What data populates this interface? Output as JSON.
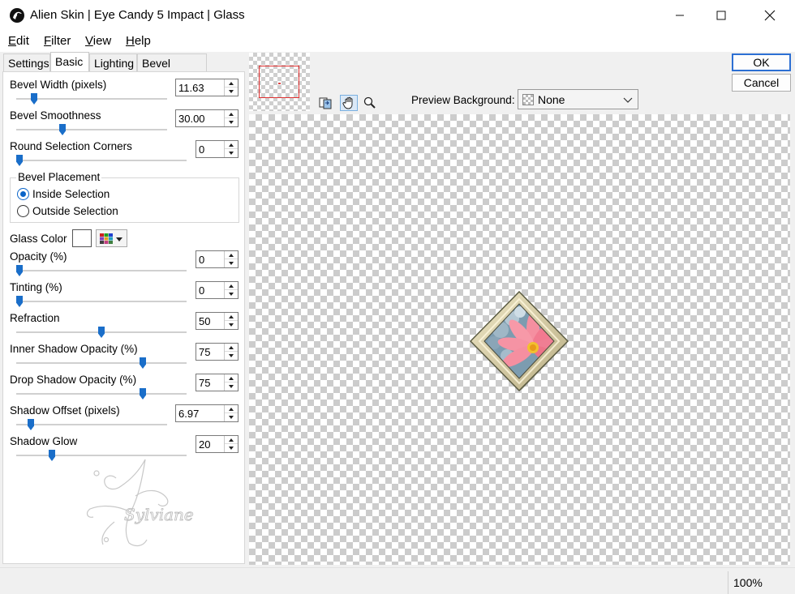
{
  "window": {
    "title": "Alien Skin | Eye Candy 5 Impact | Glass",
    "icons": [
      "app-icon",
      "minimize-icon",
      "maximize-icon",
      "close-icon"
    ]
  },
  "menu": {
    "edit": {
      "key": "E",
      "rest": "dit"
    },
    "filter": {
      "key": "F",
      "rest": "ilter"
    },
    "view": {
      "key": "V",
      "rest": "iew"
    },
    "help": {
      "key": "H",
      "rest": "elp"
    }
  },
  "tabs": [
    "Settings",
    "Basic",
    "Lighting",
    "Bevel Profile"
  ],
  "active_tab": "Basic",
  "controls": {
    "bevel_width": {
      "label": "Bevel Width (pixels)",
      "value": "11.63",
      "level": 0.1
    },
    "bevel_smoothness": {
      "label": "Bevel Smoothness",
      "value": "30.00",
      "level": 0.3
    },
    "round_corners": {
      "label": "Round Selection Corners",
      "value": "0",
      "level": 0.0
    },
    "opacity": {
      "label": "Opacity (%)",
      "value": "0",
      "level": 0.0
    },
    "tinting": {
      "label": "Tinting (%)",
      "value": "0",
      "level": 0.0
    },
    "refraction": {
      "label": "Refraction",
      "value": "50",
      "level": 0.5
    },
    "inner_shadow": {
      "label": "Inner Shadow Opacity (%)",
      "value": "75",
      "level": 0.75
    },
    "drop_shadow": {
      "label": "Drop Shadow Opacity (%)",
      "value": "75",
      "level": 0.75
    },
    "shadow_offset": {
      "label": "Shadow Offset (pixels)",
      "value": "6.97",
      "level": 0.08
    },
    "shadow_glow": {
      "label": "Shadow Glow",
      "value": "20",
      "level": 0.2
    }
  },
  "bevel_placement": {
    "legend": "Bevel Placement",
    "inside": "Inside Selection",
    "outside": "Outside Selection",
    "selected": "inside"
  },
  "glass_color": {
    "label": "Glass Color",
    "value": "#ffffff"
  },
  "preview_background": {
    "label": "Preview Background:",
    "value": "None"
  },
  "watermark_text": "Sylviane",
  "buttons": {
    "ok": "OK",
    "cancel": "Cancel"
  },
  "status": {
    "zoom": "100%"
  },
  "colors": {
    "accent": "#1a6ec9",
    "nav_rect": "#e03030",
    "frame": "#d8cfa6"
  }
}
